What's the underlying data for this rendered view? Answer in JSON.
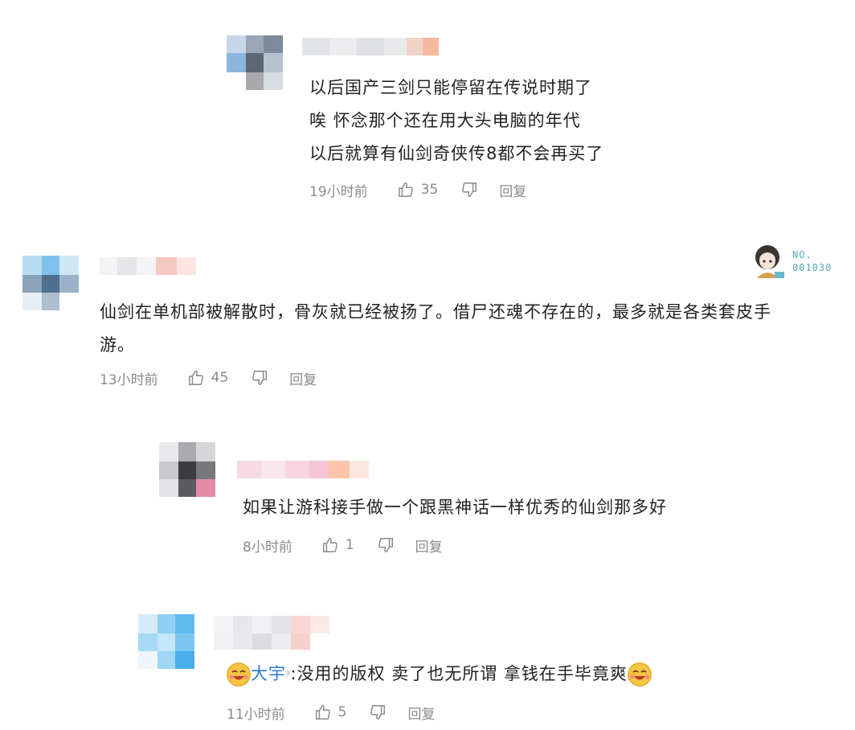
{
  "comments": [
    {
      "lines": [
        "以后国产三剑只能停留在传说时期了",
        "唉 怀念那个还在用大头电脑的年代",
        "以后就算有仙剑奇侠传8都不会再买了"
      ],
      "time": "19小时前",
      "likes": "35",
      "reply": "回复"
    },
    {
      "lines": [
        "仙剑在单机部被解散时，骨灰就已经被扬了。借尸还魂不存在的，最多就是各类套皮手",
        "游。"
      ],
      "time": "13小时前",
      "likes": "45",
      "reply": "回复",
      "badge_text": [
        "NO.",
        "001030"
      ]
    },
    {
      "lines": [
        "如果让游科接手做一个跟黑神话一样优秀的仙剑那多好"
      ],
      "time": "8小时前",
      "likes": "1",
      "reply": "回复"
    },
    {
      "mention": "大宇",
      "text": ":没用的版权 卖了也无所谓 拿钱在手毕竟爽",
      "time": "11小时前",
      "likes": "5",
      "reply": "回复"
    }
  ],
  "colors": {
    "meta": "#8a8a8a",
    "mention": "#2b78d8",
    "badge": "#56a9bf"
  },
  "icons": [
    "thumb-up-icon",
    "thumb-down-icon",
    "laughing-emoji-icon"
  ]
}
